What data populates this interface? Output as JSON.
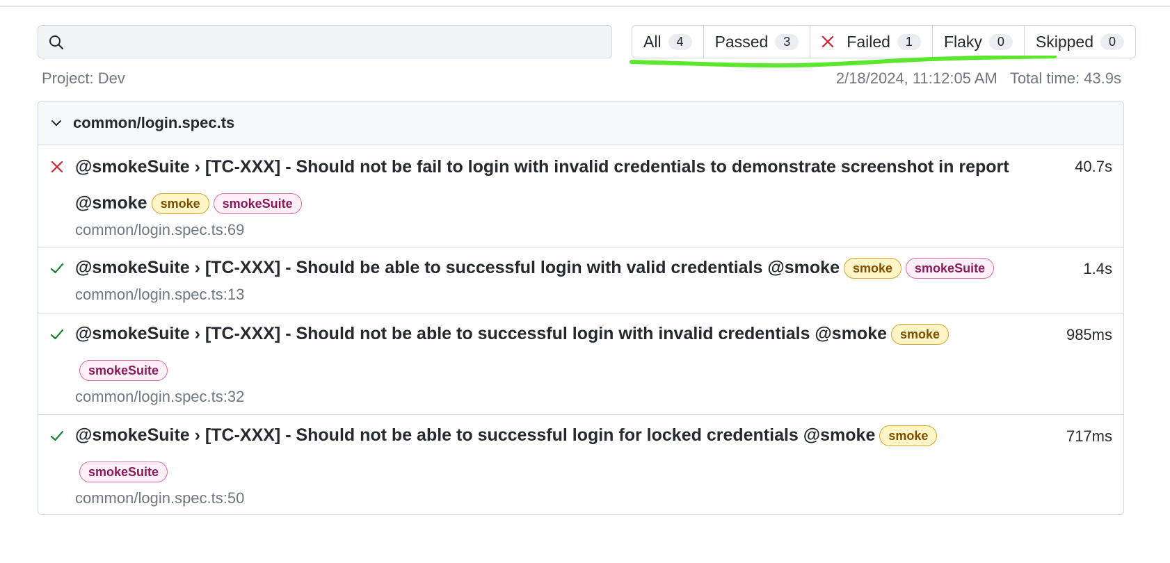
{
  "search": {
    "placeholder": "",
    "value": ""
  },
  "filters": {
    "all": {
      "label": "All",
      "count": "4"
    },
    "passed": {
      "label": "Passed",
      "count": "3"
    },
    "failed": {
      "label": "Failed",
      "count": "1"
    },
    "flaky": {
      "label": "Flaky",
      "count": "0"
    },
    "skipped": {
      "label": "Skipped",
      "count": "0"
    },
    "highlight_color": "#5ce62e"
  },
  "meta": {
    "project": "Project: Dev",
    "timestamp": "2/18/2024, 11:12:05 AM",
    "total_time": "Total time: 43.9s"
  },
  "file": {
    "name": "common/login.spec.ts",
    "tests": [
      {
        "status": "failed",
        "title": "@smokeSuite › [TC-XXX] - Should not be fail to login with invalid credentials to demonstrate screenshot in report @smoke",
        "tags": [
          "smoke",
          "smokeSuite"
        ],
        "location": "common/login.spec.ts:69",
        "duration": "40.7s"
      },
      {
        "status": "passed",
        "title": "@smokeSuite › [TC-XXX] - Should be able to successful login with valid credentials @smoke",
        "tags": [
          "smoke",
          "smokeSuite"
        ],
        "location": "common/login.spec.ts:13",
        "duration": "1.4s"
      },
      {
        "status": "passed",
        "title": "@smokeSuite › [TC-XXX] - Should not be able to successful login with invalid credentials @smoke",
        "tags": [
          "smoke",
          "smokeSuite"
        ],
        "location": "common/login.spec.ts:32",
        "duration": "985ms"
      },
      {
        "status": "passed",
        "title": "@smokeSuite › [TC-XXX] - Should not be able to successful login for locked credentials @smoke",
        "tags": [
          "smoke",
          "smokeSuite"
        ],
        "location": "common/login.spec.ts:50",
        "duration": "717ms"
      }
    ]
  },
  "colors": {
    "failed": "#cf222e",
    "passed": "#1a7f37"
  }
}
